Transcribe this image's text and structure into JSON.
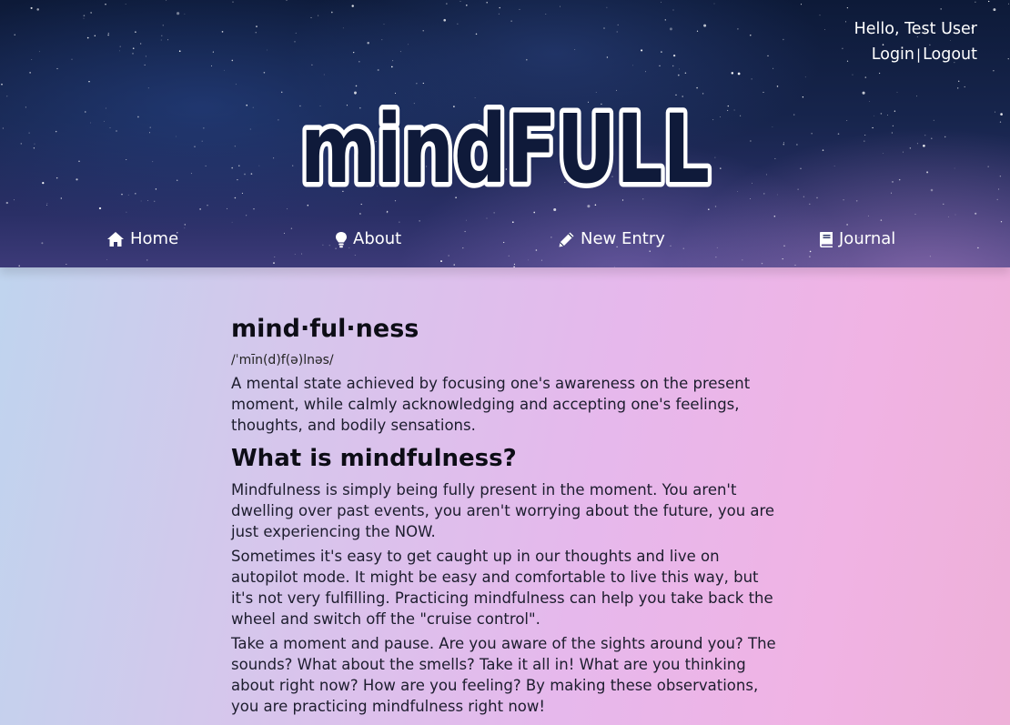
{
  "header": {
    "greeting": "Hello, Test User",
    "login_label": "Login",
    "separator": "|",
    "logout_label": "Logout",
    "logo_text_lower": "mind",
    "logo_text_upper": "FULL"
  },
  "nav": {
    "items": [
      {
        "label": "Home",
        "icon": "home-icon"
      },
      {
        "label": "About",
        "icon": "lightbulb-icon"
      },
      {
        "label": "New Entry",
        "icon": "pencil-icon"
      },
      {
        "label": "Journal",
        "icon": "book-icon"
      }
    ]
  },
  "main": {
    "word": "mind·ful·ness",
    "pronunciation": "/ˈmīn(d)f(ə)lnəs/",
    "definition": "A mental state achieved by focusing one's awareness on the present moment, while calmly acknowledging and accepting one's feelings, thoughts, and bodily sensations.",
    "heading": "What is mindfulness?",
    "paragraphs": [
      "Mindfulness is simply being fully present in the moment. You aren't dwelling over past events, you aren't worrying about the future, you are just experiencing the NOW.",
      "Sometimes it's easy to get caught up in our thoughts and live on autopilot mode. It might be easy and comfortable to live this way, but it's not very fulfilling. Practicing mindfulness can help you take back the wheel and switch off the \"cruise control\".",
      "Take a moment and pause. Are you aware of the sights around you? The sounds? What about the smells? Take it all in! What are you thinking about right now? How are you feeling? By making these observations, you are practicing mindfulness right now!"
    ]
  },
  "colors": {
    "header_bg": "#17254d",
    "text_light": "#ffffff",
    "text_dark": "#1d1d2e",
    "gradient_left": "#bcd6ee",
    "gradient_right": "#eeb0d8"
  }
}
